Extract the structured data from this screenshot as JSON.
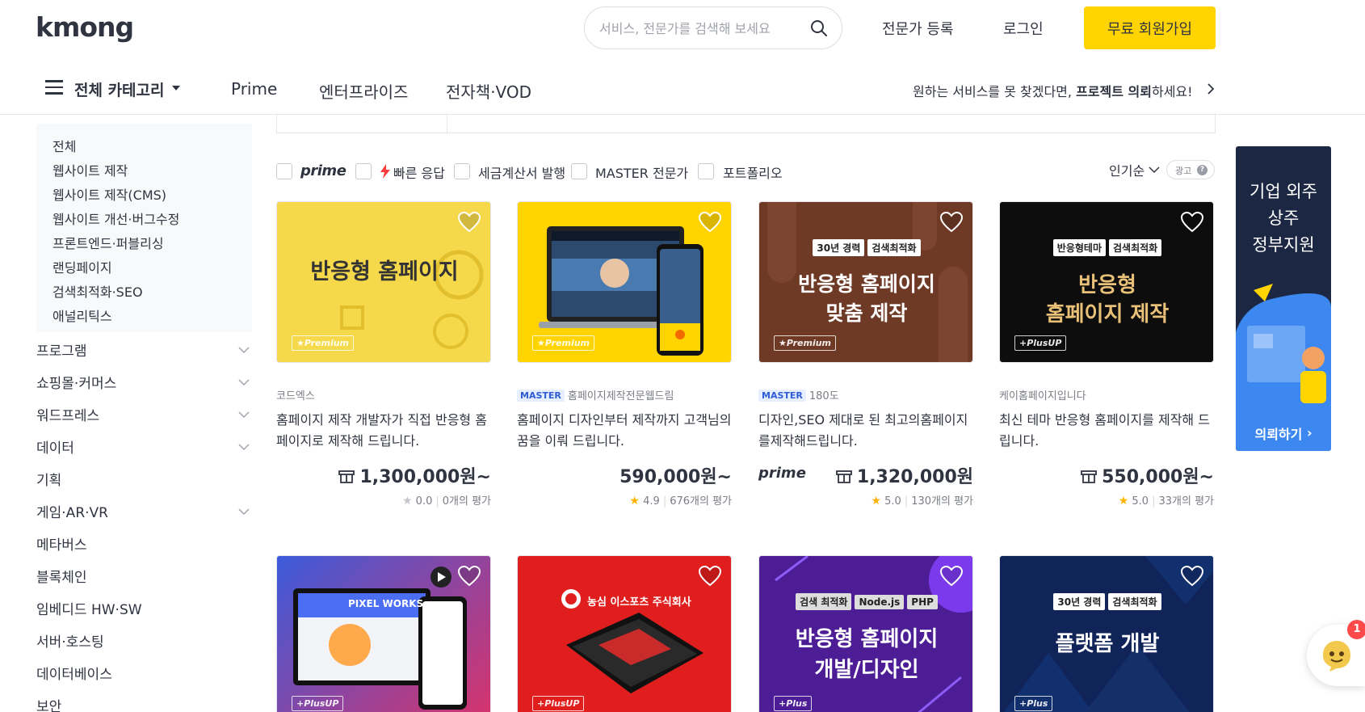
{
  "header": {
    "logo": "kmong",
    "search_placeholder": "서비스, 전문가를 검색해 보세요",
    "expert_register": "전문가 등록",
    "login": "로그인",
    "signup": "무료 회원가입"
  },
  "nav": {
    "all_categories": "전체 카테고리",
    "items": [
      "Prime",
      "엔터프라이즈",
      "전자책·VOD"
    ],
    "request_prefix": "원하는 서비스를 못 찾겠다면, ",
    "request_bold": "프로젝트 의뢰",
    "request_suffix": "하세요!"
  },
  "sidebar": {
    "sub_items": [
      "전체",
      "웹사이트 제작",
      "웹사이트 제작(CMS)",
      "웹사이트 개선·버그수정",
      "프론트엔드·퍼블리싱",
      "랜딩페이지",
      "검색최적화·SEO",
      "애널리틱스"
    ],
    "categories": [
      {
        "label": "프로그램",
        "expandable": true
      },
      {
        "label": "쇼핑몰·커머스",
        "expandable": true
      },
      {
        "label": "워드프레스",
        "expandable": true
      },
      {
        "label": "데이터",
        "expandable": true
      },
      {
        "label": "기획",
        "expandable": false
      },
      {
        "label": "게임·AR·VR",
        "expandable": true
      },
      {
        "label": "메타버스",
        "expandable": false
      },
      {
        "label": "블록체인",
        "expandable": false
      },
      {
        "label": "임베디드 HW·SW",
        "expandable": false
      },
      {
        "label": "서버·호스팅",
        "expandable": false
      },
      {
        "label": "데이터베이스",
        "expandable": false
      },
      {
        "label": "보안",
        "expandable": false
      }
    ]
  },
  "filters": {
    "prime": "prime",
    "fast": "빠른 응답",
    "tax": "세금계산서 발행",
    "master": "MASTER 전문가",
    "portfolio": "포트폴리오",
    "sort": "인기순",
    "ad": "광고"
  },
  "cards": [
    {
      "seller": "코드엑스",
      "master": false,
      "title": "홈페이지 제작 개발자가 직접 반응형 홈페이지로 제작해 드립니다.",
      "price": "1,300,000원~",
      "coupon": true,
      "prime": false,
      "rating": "0.0",
      "reviews": "0개의 평가",
      "thumb_badge": "Premium",
      "thumb_lines": [
        "반응형 홈페이지"
      ],
      "thumb_tags": []
    },
    {
      "seller": "홈페이지제작전문웹드림",
      "master": true,
      "master_label": "MASTER",
      "title": "홈페이지 디자인부터 제작까지 고객님의 꿈을 이뤄 드립니다.",
      "price": "590,000원~",
      "coupon": false,
      "prime": false,
      "rating": "4.9",
      "reviews": "676개의 평가",
      "thumb_badge": "Premium",
      "thumb_lines": [],
      "thumb_tags": []
    },
    {
      "seller": "180도",
      "master": true,
      "master_label": "MASTER",
      "title": "디자인,SEO 제대로 된 최고의홈페이지를제작해드립니다.",
      "price": "1,320,000원",
      "coupon": true,
      "prime": true,
      "prime_label": "prime",
      "rating": "5.0",
      "reviews": "130개의 평가",
      "thumb_badge": "Premium",
      "thumb_lines": [
        "반응형 홈페이지",
        "맞춤 제작"
      ],
      "thumb_tags": [
        "30년 경력",
        "검색최적화"
      ]
    },
    {
      "seller": "케이홈페이지입니다",
      "master": false,
      "title": "최신 테마 반응형 홈페이지를 제작해 드립니다.",
      "price": "550,000원~",
      "coupon": true,
      "prime": false,
      "rating": "5.0",
      "reviews": "33개의 평가",
      "thumb_badge": "+PlusUP",
      "thumb_lines": [
        "반응형",
        "홈페이지 제작"
      ],
      "thumb_tags": [
        "반응형테마",
        "검색최적화"
      ]
    }
  ],
  "cards_row2": [
    {
      "thumb_badge": "+PlusUP",
      "thumb_lines": [
        "PIXEL WORKS"
      ],
      "thumb_tags": []
    },
    {
      "thumb_badge": "+PlusUP",
      "thumb_lines": [
        "농심 이스포츠 주식회사"
      ],
      "thumb_tags": []
    },
    {
      "thumb_badge": "+Plus",
      "thumb_lines": [
        "반응형 홈페이지",
        "개발/디자인"
      ],
      "thumb_tags": [
        "검색 최적화",
        "Node.js",
        "PHP"
      ]
    },
    {
      "thumb_badge": "+Plus",
      "thumb_lines": [
        "플랫폼 개발"
      ],
      "thumb_tags": [
        "30년 경력",
        "검색최적화"
      ]
    }
  ],
  "banner": {
    "lines": [
      "기업 외주",
      "상주",
      "정부지원"
    ],
    "button": "의뢰하기"
  },
  "chat": {
    "badge": "1"
  },
  "colors": {
    "accent": "#ffd400",
    "star": "#ffb300",
    "master_bg": "#e5efff",
    "banner_bg": "#1c2843"
  }
}
